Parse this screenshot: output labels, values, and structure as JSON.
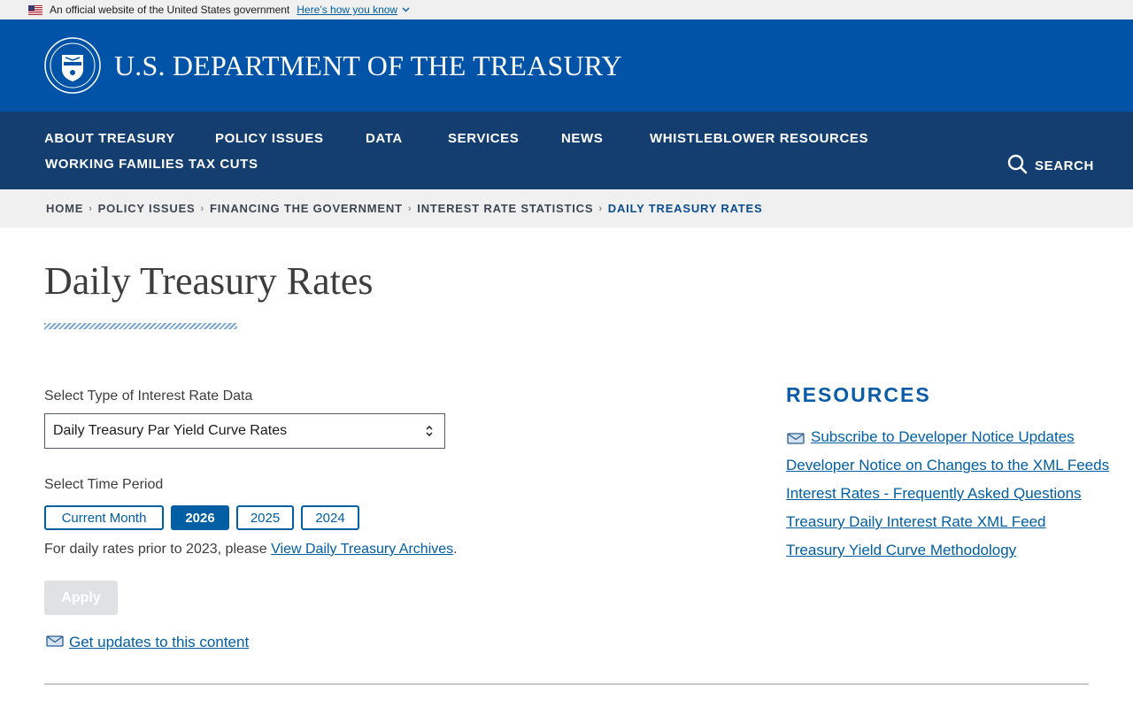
{
  "gov_banner": {
    "text": "An official website of the United States government",
    "link": "Here’s how you know"
  },
  "header": {
    "title": "U.S. DEPARTMENT OF THE TREASURY"
  },
  "nav": {
    "items": [
      "ABOUT TREASURY",
      "POLICY ISSUES",
      "DATA",
      "SERVICES",
      "NEWS",
      "WHISTLEBLOWER RESOURCES",
      "WORKING FAMILIES TAX CUTS"
    ],
    "search_label": "SEARCH"
  },
  "breadcrumb": [
    "HOME",
    "POLICY ISSUES",
    "FINANCING THE GOVERNMENT",
    "INTEREST RATE STATISTICS",
    "DAILY TREASURY RATES"
  ],
  "page": {
    "title": "Daily Treasury Rates"
  },
  "form": {
    "type_label": "Select Type of Interest Rate Data",
    "type_value": "Daily Treasury Par Yield Curve Rates",
    "period_label": "Select Time Period",
    "periods": [
      "Current Month",
      "2026",
      "2025",
      "2024"
    ],
    "active_period": "2026",
    "archive_prefix": "For daily rates prior to 2023, please ",
    "archive_link": "View Daily Treasury Archives",
    "archive_suffix": ".",
    "apply_label": "Apply",
    "updates_link": "Get updates to this content"
  },
  "resources": {
    "heading": "RESOURCES",
    "links": [
      "Subscribe to Developer Notice Updates",
      "Developer Notice on Changes to the XML Feeds",
      "Interest Rates - Frequently Asked Questions",
      "Treasury Daily Interest Rate XML Feed",
      "Treasury Yield Curve Methodology"
    ]
  },
  "colors": {
    "header_blue": "#0053a6",
    "nav_blue": "#133e6f",
    "link_blue": "#005ea2",
    "resources_blue": "#0b5ca8"
  },
  "icons": {
    "flag": "us-flag-icon",
    "seal": "treasury-seal-icon",
    "search": "search-icon",
    "mail": "envelope-icon",
    "chevron": "chevron-down-icon"
  }
}
